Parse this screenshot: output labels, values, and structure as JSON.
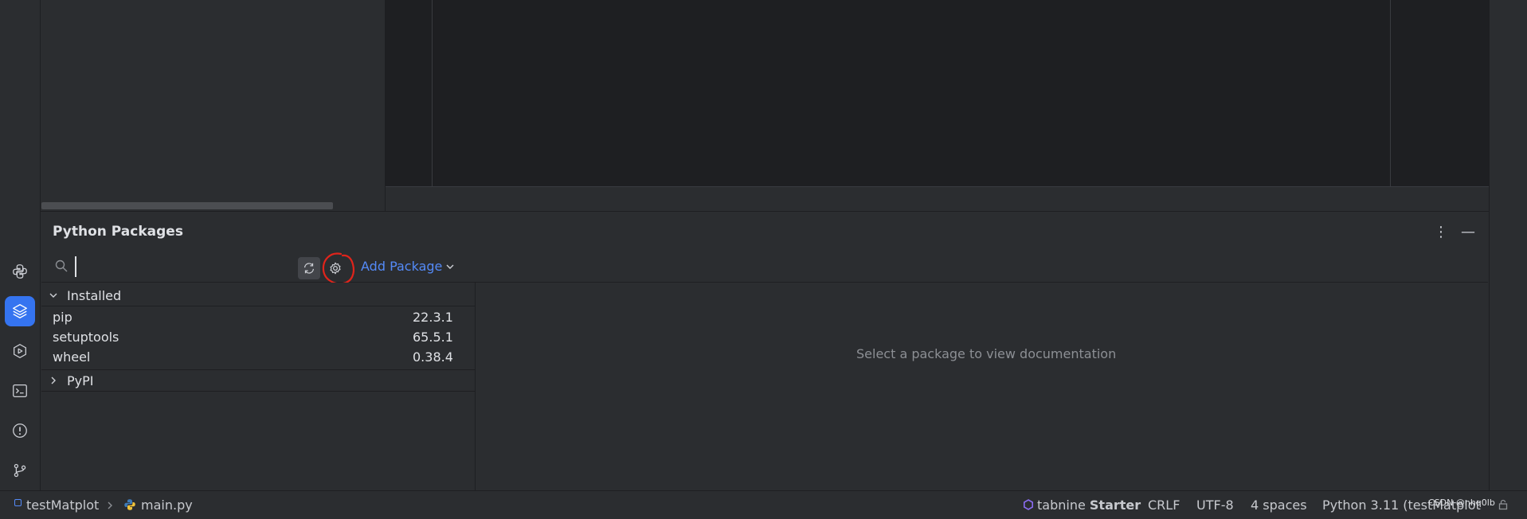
{
  "tool_window": {
    "title": "Python Packages",
    "search": {
      "value": "",
      "placeholder": ""
    },
    "add_package_label": "Add Package",
    "more_icon": "⋮",
    "hide_icon": "—"
  },
  "packages": {
    "installed_label": "Installed",
    "installed": [
      {
        "name": "pip",
        "version": "22.3.1"
      },
      {
        "name": "setuptools",
        "version": "65.5.1"
      },
      {
        "name": "wheel",
        "version": "0.38.4"
      }
    ],
    "pypi_label": "PyPI"
  },
  "documentation": {
    "placeholder": "Select a package to view documentation"
  },
  "statusbar": {
    "project": "testMatplot",
    "file": "main.py",
    "tabnine_brand": "tabnine",
    "tabnine_tier": "Starter",
    "line_separator": "CRLF",
    "encoding": "UTF-8",
    "indent": "4 spaces",
    "interpreter": "Python 3.11 (testMatplot)"
  },
  "watermark": "CSDN @nhq0lb",
  "colors": {
    "accent": "#3574f0",
    "link": "#548af7",
    "annotation": "#e0241b",
    "background": "#2b2d30"
  },
  "icons": {
    "toolstrip": [
      "python-console-icon",
      "python-packages-icon",
      "services-icon",
      "terminal-icon",
      "problems-icon",
      "git-icon"
    ],
    "toolbar": [
      "search-icon",
      "refresh-icon",
      "settings-icon"
    ]
  }
}
